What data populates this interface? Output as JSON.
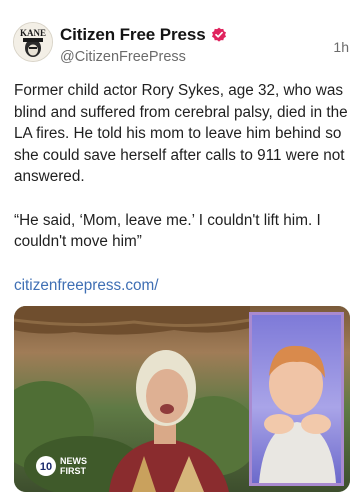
{
  "post": {
    "author_name": "Citizen Free Press",
    "handle": "@CitizenFreePress",
    "timestamp": "1h",
    "avatar_text": "KANE",
    "paragraphs": [
      "Former child actor Rory Sykes, age 32, who was blind and suffered from cerebral palsy, died in the LA fires. He told his mom to leave him behind so she could save herself after calls to 911 were not answered.",
      "“He said, ‘Mom, leave me.’ I couldn't lift him. I couldn't move him”"
    ],
    "link_text": "citizenfreepress.com/"
  },
  "media": {
    "logo_number": "10",
    "logo_line1": "NEWS",
    "logo_line2": "FIRST"
  },
  "colors": {
    "verified_badge": "#e0245e",
    "link": "#3f6fb4",
    "inset_border": "#a98ad0"
  }
}
